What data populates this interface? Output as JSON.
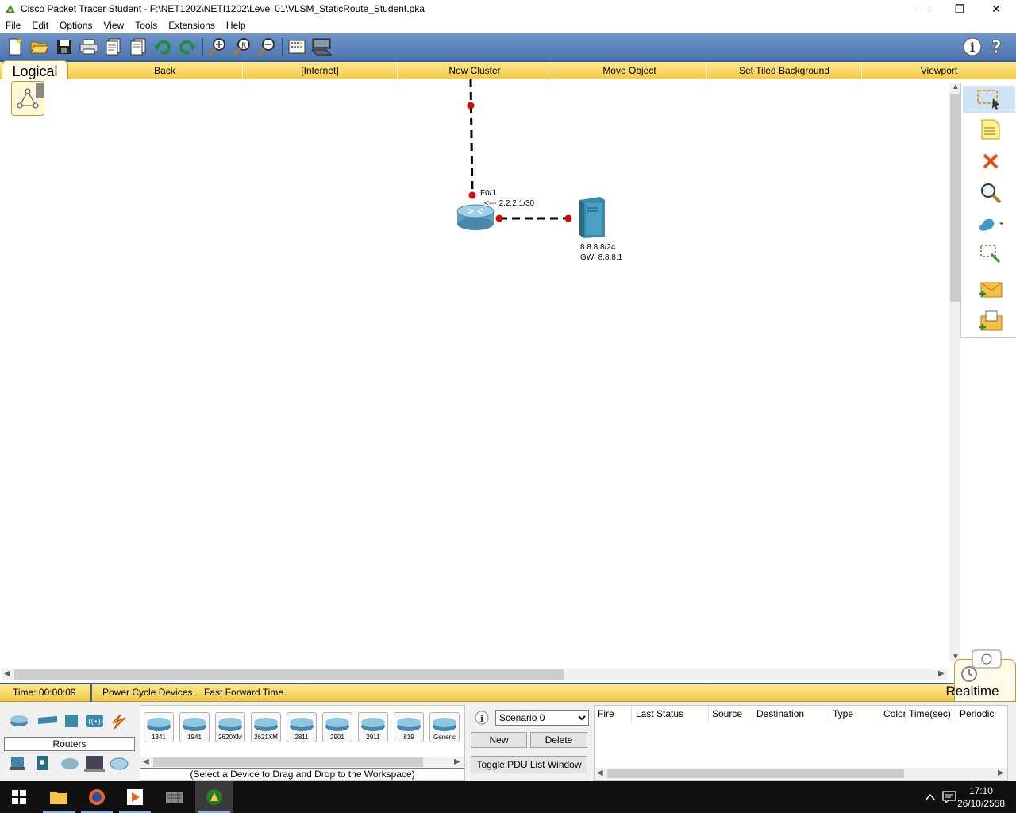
{
  "window": {
    "title": "Cisco Packet Tracer Student - F:\\NET1202\\NETI1202\\Level 01\\VLSM_StaticRoute_Student.pka",
    "minimize": "—",
    "maximize": "❐",
    "close": "✕"
  },
  "menu": [
    "File",
    "Edit",
    "Options",
    "View",
    "Tools",
    "Extensions",
    "Help"
  ],
  "toolbar": {
    "icons": [
      "new-file-icon",
      "open-folder-icon",
      "save-icon",
      "print-icon",
      "activity-wizard-icon",
      "copy-icon",
      "undo-icon",
      "redo-icon",
      "zoom-in-icon",
      "zoom-reset-icon",
      "zoom-out-icon",
      "palette-icon",
      "custom-device-icon",
      "info-icon",
      "help-icon"
    ]
  },
  "logical_bar": {
    "tab": "Logical",
    "items": [
      "Back",
      "[Internet]",
      "New Cluster",
      "Move Object",
      "Set Tiled Background",
      "Viewport"
    ]
  },
  "topology": {
    "router_interface": "F0/1",
    "router_ip": "<--- 2.2.2.1/30",
    "server_ip": "8.8.8.8/24",
    "server_gw": "GW: 8.8.8.1"
  },
  "time_bar": {
    "time": "Time: 00:00:09",
    "power_cycle": "Power Cycle Devices",
    "fast_forward": "Fast Forward Time",
    "realtime": "Realtime"
  },
  "device_panel": {
    "category": "Routers",
    "devices": [
      "1841",
      "1941",
      "2620XM",
      "2621XM",
      "2811",
      "2901",
      "2911",
      "819",
      "Generic"
    ],
    "hint": "(Select a Device to Drag and Drop to the Workspace)"
  },
  "scenario": {
    "selected": "Scenario 0",
    "new_label": "New",
    "delete_label": "Delete",
    "toggle_label": "Toggle PDU List Window"
  },
  "pdu_table": {
    "columns": [
      "Fire",
      "Last Status",
      "Source",
      "Destination",
      "Type",
      "Color",
      "Time(sec)",
      "Periodic"
    ]
  },
  "taskbar": {
    "time": "17:10",
    "date": "26/10/2558"
  },
  "colors": {
    "toolbar_blue": "#4c74ae",
    "bar_yellow": "#f2c94c",
    "link_red": "#e00000"
  }
}
